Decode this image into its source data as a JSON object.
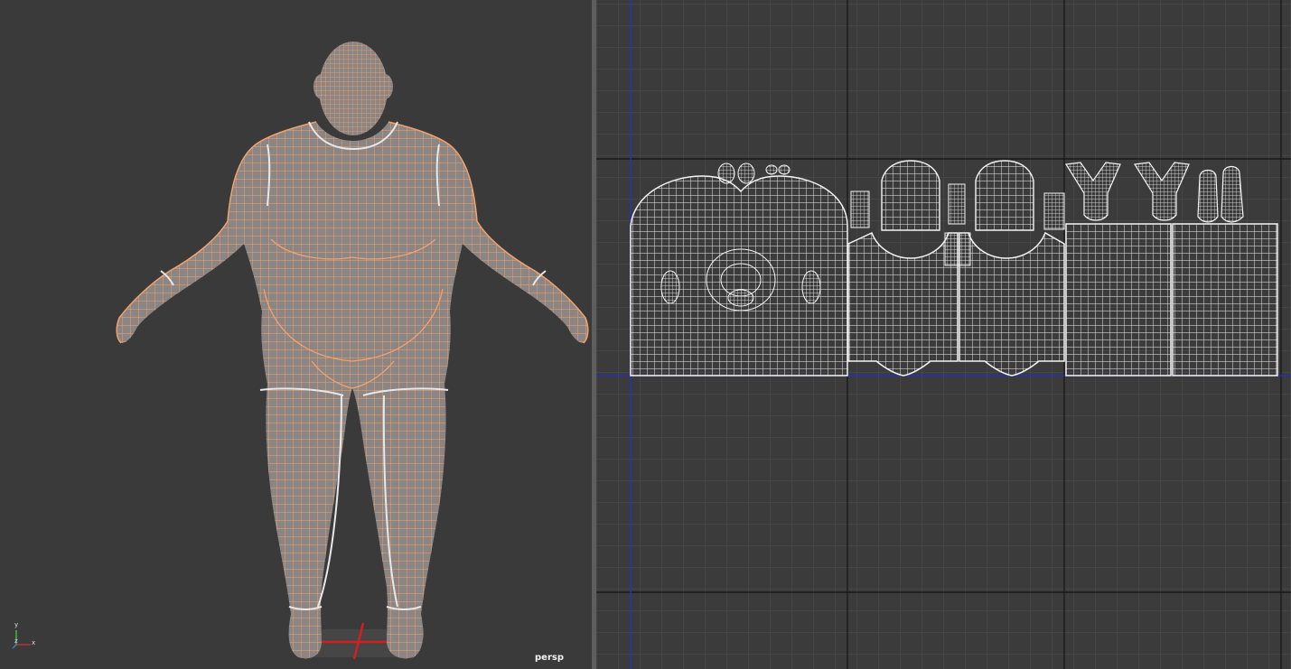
{
  "perspective_view": {
    "camera_label": "persp",
    "axis_labels": {
      "y": "y",
      "z": "z",
      "x": "x"
    },
    "colors": {
      "background": "#3a3a3a",
      "mesh_fill": "#8b8584",
      "wire": "#f2a26e",
      "seam": "#e8e8e8",
      "ground": "#d22020"
    }
  },
  "uv_view": {
    "colors": {
      "background": "#3b3b3b",
      "grid_minor": "#4f4f4f",
      "grid_major": "#141414",
      "axis": "#2a2ad8",
      "uv_wire": "#f5f5f5"
    }
  }
}
